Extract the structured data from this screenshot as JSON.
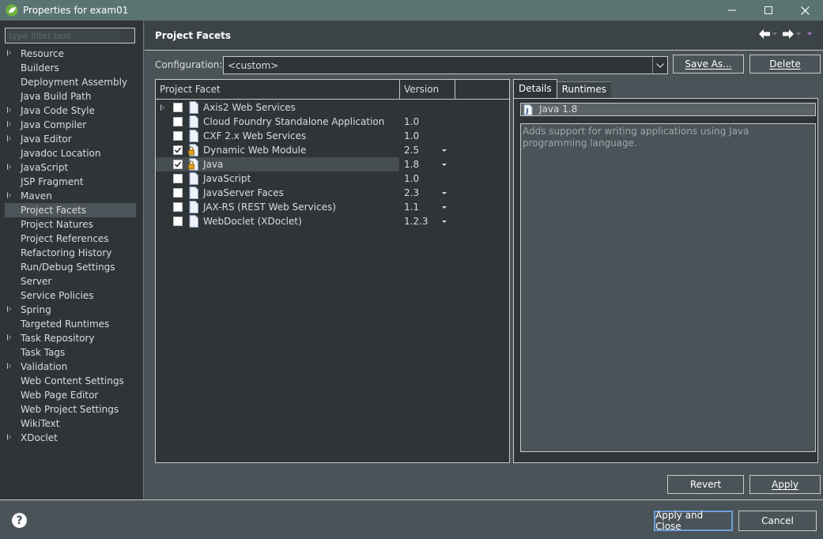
{
  "window": {
    "title": "Properties for exam01",
    "controls": [
      "—",
      "☐",
      "✕"
    ]
  },
  "sidebar": {
    "filter_placeholder": "type filter text",
    "items": [
      {
        "label": "Resource",
        "expandable": true
      },
      {
        "label": "Builders",
        "expandable": false
      },
      {
        "label": "Deployment Assembly",
        "expandable": false
      },
      {
        "label": "Java Build Path",
        "expandable": false
      },
      {
        "label": "Java Code Style",
        "expandable": true
      },
      {
        "label": "Java Compiler",
        "expandable": true
      },
      {
        "label": "Java Editor",
        "expandable": true
      },
      {
        "label": "Javadoc Location",
        "expandable": false
      },
      {
        "label": "JavaScript",
        "expandable": true
      },
      {
        "label": "JSP Fragment",
        "expandable": false
      },
      {
        "label": "Maven",
        "expandable": true
      },
      {
        "label": "Project Facets",
        "expandable": false,
        "selected": true
      },
      {
        "label": "Project Natures",
        "expandable": false
      },
      {
        "label": "Project References",
        "expandable": false
      },
      {
        "label": "Refactoring History",
        "expandable": false
      },
      {
        "label": "Run/Debug Settings",
        "expandable": false
      },
      {
        "label": "Server",
        "expandable": false
      },
      {
        "label": "Service Policies",
        "expandable": false
      },
      {
        "label": "Spring",
        "expandable": true
      },
      {
        "label": "Targeted Runtimes",
        "expandable": false
      },
      {
        "label": "Task Repository",
        "expandable": true
      },
      {
        "label": "Task Tags",
        "expandable": false
      },
      {
        "label": "Validation",
        "expandable": true
      },
      {
        "label": "Web Content Settings",
        "expandable": false
      },
      {
        "label": "Web Page Editor",
        "expandable": false
      },
      {
        "label": "Web Project Settings",
        "expandable": false
      },
      {
        "label": "WikiText",
        "expandable": false
      },
      {
        "label": "XDoclet",
        "expandable": true
      }
    ]
  },
  "page": {
    "title": "Project Facets",
    "config_label": "Configuration:",
    "config_value": "<custom>",
    "save_as_label": "Save As...",
    "delete_label": "Delete"
  },
  "facets": {
    "col_facet": "Project Facet",
    "col_version": "Version",
    "rows": [
      {
        "name": "Axis2 Web Services",
        "version": "",
        "checked": false,
        "expandable": true,
        "dropdown": false,
        "selected": false
      },
      {
        "name": "Cloud Foundry Standalone Application",
        "version": "1.0",
        "checked": false,
        "expandable": false,
        "dropdown": false,
        "selected": false
      },
      {
        "name": "CXF 2.x Web Services",
        "version": "1.0",
        "checked": false,
        "expandable": false,
        "dropdown": false,
        "selected": false
      },
      {
        "name": "Dynamic Web Module",
        "version": "2.5",
        "checked": true,
        "expandable": false,
        "dropdown": true,
        "selected": false,
        "locked": true
      },
      {
        "name": "Java",
        "version": "1.8",
        "checked": true,
        "expandable": false,
        "dropdown": true,
        "selected": true,
        "locked": true
      },
      {
        "name": "JavaScript",
        "version": "1.0",
        "checked": false,
        "expandable": false,
        "dropdown": false,
        "selected": false
      },
      {
        "name": "JavaServer Faces",
        "version": "2.3",
        "checked": false,
        "expandable": false,
        "dropdown": true,
        "selected": false
      },
      {
        "name": "JAX-RS (REST Web Services)",
        "version": "1.1",
        "checked": false,
        "expandable": false,
        "dropdown": true,
        "selected": false
      },
      {
        "name": "WebDoclet (XDoclet)",
        "version": "1.2.3",
        "checked": false,
        "expandable": false,
        "dropdown": true,
        "selected": false
      }
    ]
  },
  "details": {
    "tabs": [
      "Details",
      "Runtimes"
    ],
    "facet_title": "Java 1.8",
    "description": "Adds support for writing applications using Java programming language."
  },
  "buttons": {
    "revert": "Revert",
    "apply": "Apply",
    "apply_close": "Apply and Close",
    "cancel": "Cancel",
    "help": "?"
  },
  "colors": {
    "accent": "#6fa0d6",
    "titlebar": "#5a7472",
    "panel": "#2f3437",
    "background": "#4a5358"
  }
}
